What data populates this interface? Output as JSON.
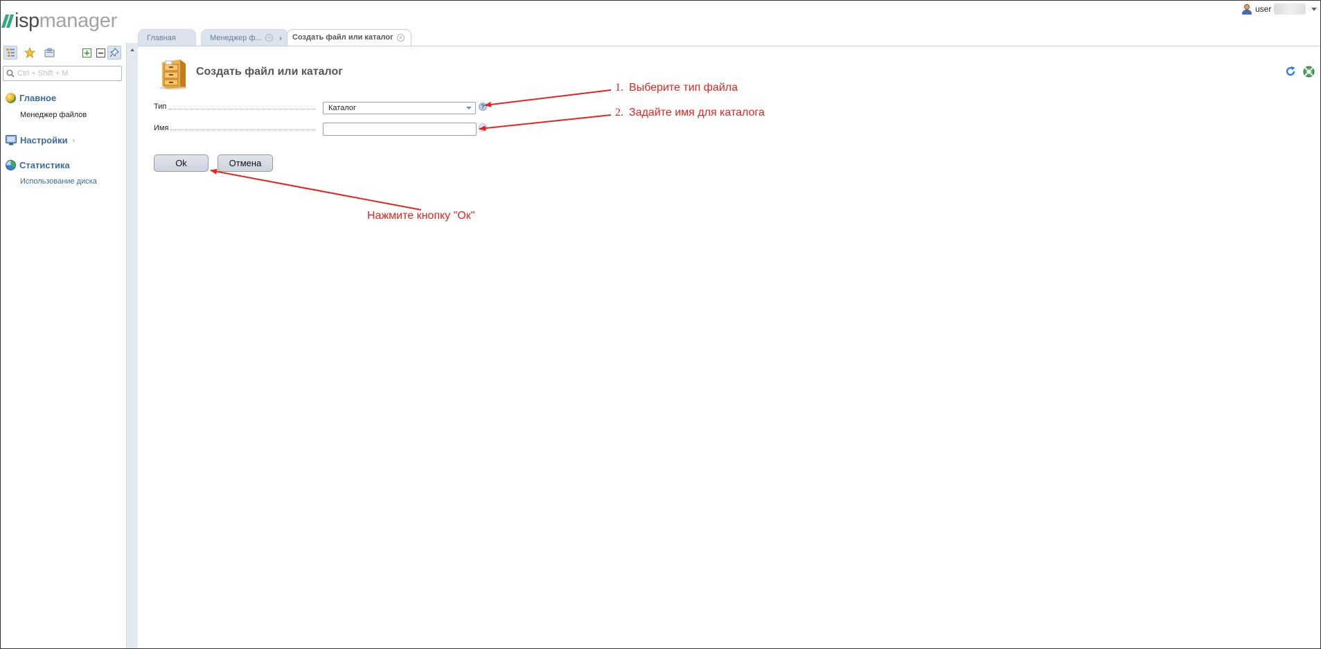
{
  "logo": {
    "part1": "isp",
    "part2": "manager"
  },
  "user": {
    "name": "user"
  },
  "sidebar": {
    "search_placeholder": "Ctrl + Shift + M",
    "groups": [
      {
        "label": "Главное",
        "items": [
          {
            "label": "Менеджер файлов"
          }
        ]
      },
      {
        "label": "Настройки",
        "items": []
      },
      {
        "label": "Статистика",
        "items": [
          {
            "label": "Использование диска"
          }
        ]
      }
    ]
  },
  "tabs": [
    {
      "label": "Главная"
    },
    {
      "label": "Менеджер ф..."
    },
    {
      "label": "Создать файл или каталог"
    }
  ],
  "page": {
    "title": "Создать файл или каталог"
  },
  "form": {
    "type_label": "Тип",
    "type_value": "Каталог",
    "name_label": "Имя",
    "name_value": "",
    "hint_glyph": "?",
    "ok_label": "Ok",
    "cancel_label": "Отмена"
  },
  "annotations": [
    {
      "num": "1.",
      "text": "Выберите тип файла"
    },
    {
      "num": "2.",
      "text": "Задайте имя для каталога"
    },
    {
      "text": "Нажмите кнопку \"Ок\""
    }
  ],
  "colors": {
    "accent": "#3b6a9e",
    "annotation": "#e8221f",
    "logo_green": "#35a97d"
  }
}
